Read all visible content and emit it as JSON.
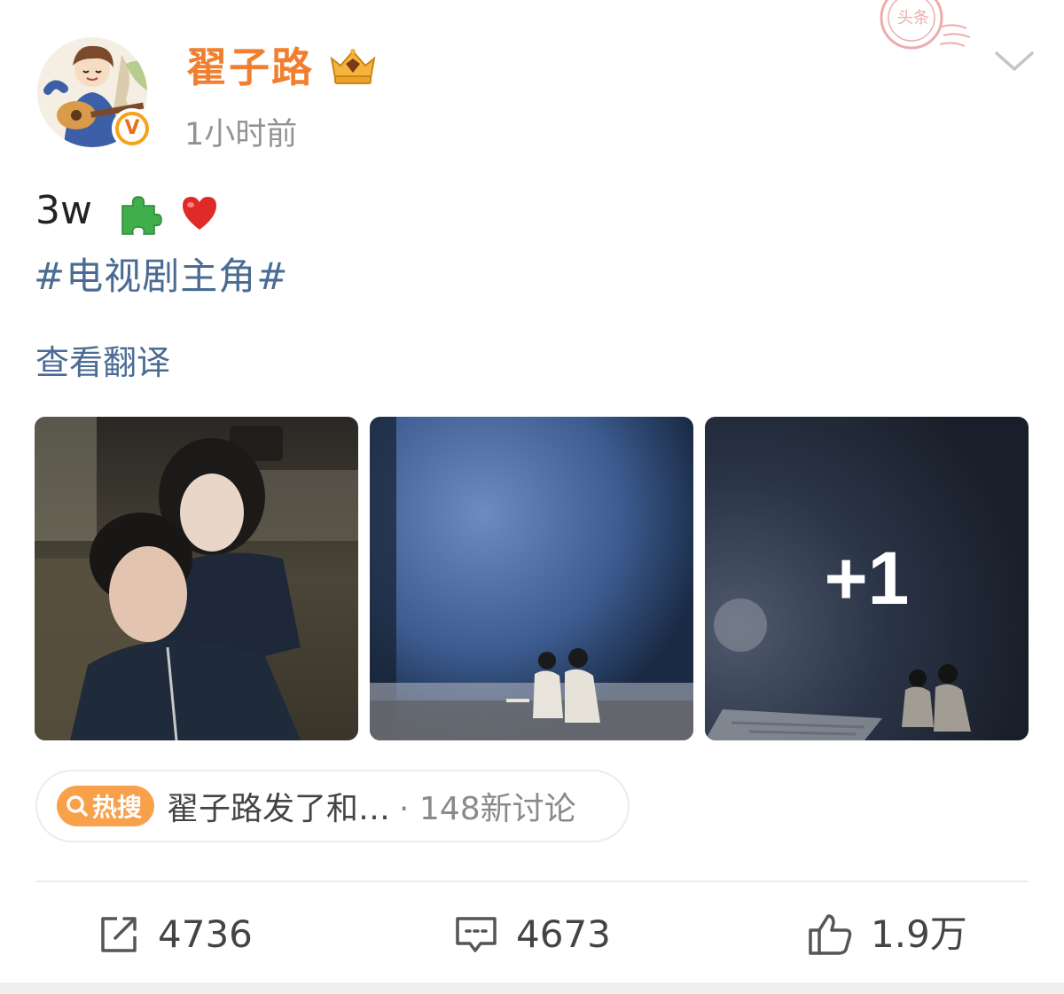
{
  "user": {
    "name": "翟子路",
    "post_time": "1小时前",
    "verified_mark": "V"
  },
  "stamp_text": "头条",
  "post": {
    "text": "3w",
    "emojis": [
      "puzzle-piece-emoji",
      "red-heart-emoji"
    ],
    "hashtag": "#电视剧主角#",
    "translate_link": "查看翻译"
  },
  "images": {
    "more_count": "+1"
  },
  "trending": {
    "badge_label": "热搜",
    "text": "翟子路发了和…",
    "count": "· 148新讨论"
  },
  "actions": {
    "repost_count": "4736",
    "comment_count": "4673",
    "like_count": "1.9万"
  },
  "colors": {
    "username": "#f07f2f",
    "link": "#4a6b93",
    "trend_badge": "#f9a14a"
  }
}
